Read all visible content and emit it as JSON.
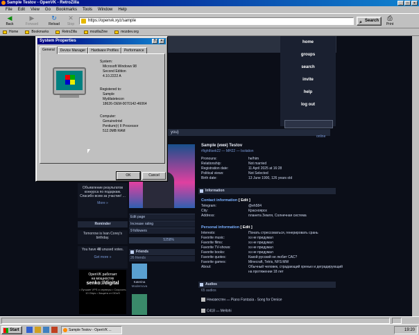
{
  "window": {
    "title": "Sample Testov - OpenVK - RetroZilla"
  },
  "menu": [
    "File",
    "Edit",
    "View",
    "Go",
    "Bookmarks",
    "Tools",
    "Window",
    "Help"
  ],
  "toolbar": {
    "back": "Back",
    "forward": "Forward",
    "reload": "Reload",
    "stop": "Stop",
    "print": "Print"
  },
  "url": "https://openvk.xyz/sample",
  "search_label": "Search",
  "bookmarks": [
    "Home",
    "Bookmarks",
    "RetroZilla",
    "mozillaZine",
    "mozdev.org"
  ],
  "vk": {
    "nav": [
      "home",
      "groups",
      "search",
      "invite",
      "help",
      "log out"
    ],
    "online": "online",
    "strip": "you)",
    "name": "Sample (имя) Testov",
    "subtitle": "#lightItsek22 — MH22 — Isolation",
    "info": [
      [
        "Pronouns:",
        "he/him"
      ],
      [
        "Relationship:",
        "Not married"
      ],
      [
        "Registration date:",
        "11 April 2025 at 16:28"
      ],
      [
        "Political views:",
        "Not Selected"
      ],
      [
        "Birth date:",
        "13 June 1900, 126 years old"
      ]
    ],
    "information_title": "Information",
    "contact_title": "Contact information",
    "edit": "[ Edit ]",
    "contact": [
      [
        "Telegram:",
        "@eh584"
      ],
      [
        "City:",
        "Красноярск"
      ],
      [
        "Address:",
        "планета Земля, Солнечная система"
      ]
    ],
    "personal_title": "Personal information",
    "personal": [
      [
        "Interests:",
        "Понать стрессоваться, генерировать срань"
      ],
      [
        "Favorite music:",
        "хз не придумал"
      ],
      [
        "Favorite films:",
        "хз не придумал"
      ],
      [
        "Favorite TV-shows:",
        "хз не придумал"
      ],
      [
        "Favorite books:",
        "хз не придумал"
      ],
      [
        "Favorite quotes:",
        "Какой русский не любит САС?"
      ],
      [
        "Favorite games:",
        "Minecraft, Tetris, NFS:MW"
      ],
      [
        "About:",
        "Обычный человек, страдающий хренью и деградирующий на протяжении 18 лет"
      ]
    ],
    "audios_title": "Audios",
    "audios_count": "65 audios",
    "audios": [
      "Неизвестен — Piano Fantasia - Song for Denise",
      "C418 — Mellohi"
    ],
    "edit_page": "Edit page",
    "increase_rating": "Increase rating",
    "followers": "9 followers",
    "rating": "5258%",
    "friends_title": "Friends",
    "friends_count": "26 friends",
    "friend_name": "Katerina",
    "friend_sub": "Modernova",
    "left_ad": "Объявление результатов конкурса по подаркам. Спасибо всем за участие! ...",
    "more": "More »",
    "reminder_title": "Reminder",
    "reminder_text": "Tomorrow is Ivan Corey's birthday.",
    "votes_text1": "You have ",
    "votes_num": "40",
    "votes_text2": " unused votes.",
    "get_more": "Get more »",
    "banner_line1": "OpenVK работает",
    "banner_line2": "на мощностях",
    "banner_line3": "senko://digital",
    "banner_small": "• Лучшие VPS и серверы • Скорость 10 Gbps • Защита от DDoS"
  },
  "dialog": {
    "title": "System Properties",
    "tabs": [
      "General",
      "Device Manager",
      "Hardware Profiles",
      "Performance"
    ],
    "system_label": "System:",
    "system": [
      "Microsoft Windows 98",
      "Second Edition",
      "4.10.2222 A"
    ],
    "registered_label": "Registered to:",
    "registered": [
      "Sample",
      "Mydilatetecon",
      "18626-OEM-0070142-46064"
    ],
    "computer_label": "Computer:",
    "computer": [
      "GenuineIntel",
      "Pentium(r) II Processor",
      "512.0MB RAM"
    ],
    "ok": "OK",
    "cancel": "Cancel"
  },
  "taskbar": {
    "start": "Start",
    "task": "Sample Testov - OpenVK ...",
    "clock": "19:20"
  }
}
